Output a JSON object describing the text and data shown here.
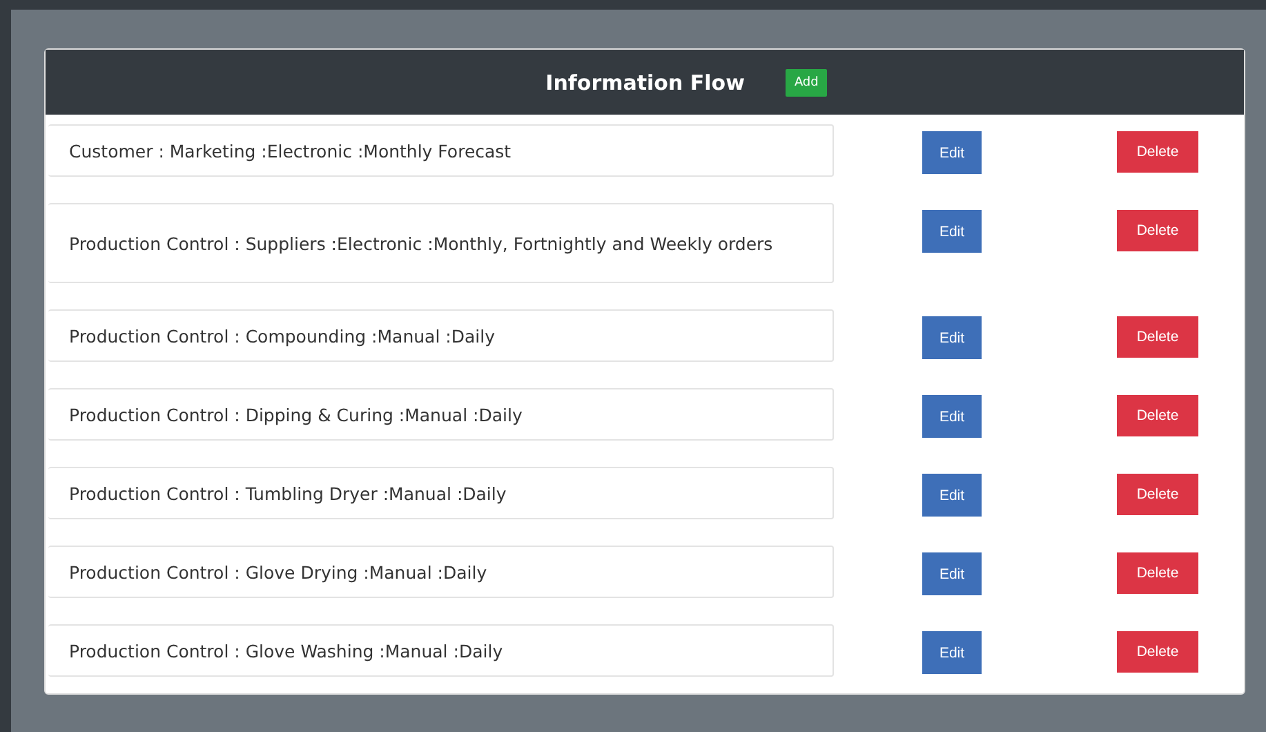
{
  "panel": {
    "title": "Information Flow",
    "add_button": "Add"
  },
  "flows": [
    {
      "text": "Customer : Marketing :Electronic :Monthly Forecast",
      "edit": "Edit",
      "delete": "Delete"
    },
    {
      "text": "Production Control : Suppliers :Electronic :Monthly, Fortnightly and Weekly orders",
      "edit": "Edit",
      "delete": "Delete"
    },
    {
      "text": "Production Control : Compounding :Manual :Daily",
      "edit": "Edit",
      "delete": "Delete"
    },
    {
      "text": "Production Control : Dipping & Curing :Manual :Daily",
      "edit": "Edit",
      "delete": "Delete"
    },
    {
      "text": "Production Control : Tumbling Dryer :Manual :Daily",
      "edit": "Edit",
      "delete": "Delete"
    },
    {
      "text": "Production Control : Glove Drying :Manual :Daily",
      "edit": "Edit",
      "delete": "Delete"
    },
    {
      "text": "Production Control : Glove Washing :Manual :Daily",
      "edit": "Edit",
      "delete": "Delete"
    }
  ]
}
